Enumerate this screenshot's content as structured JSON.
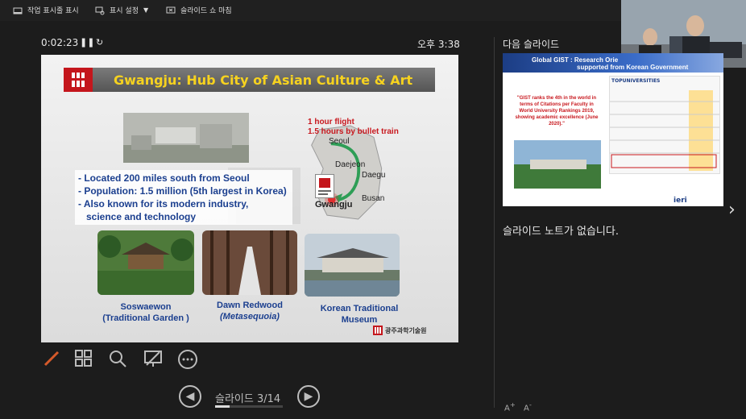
{
  "toolbar": {
    "taskbar_label": "작업 표시줄 표시",
    "display_settings_label": "표시 설정",
    "end_show_label": "슬라이드 쇼 마침"
  },
  "presenter": {
    "timer": "0:02:23",
    "clock": "오후 3:38",
    "next_slide_label": "다음 슬라이드",
    "notes_text": "슬라이드 노트가 없습니다.",
    "slide_counter": "슬라이드 3/14",
    "slide_progress": 0.2143
  },
  "current_slide": {
    "title": "Gwangju: Hub City of Asian Culture & Art",
    "bullets": [
      "- Located 200 miles south from Seoul",
      "- Population: 1.5 million (5th largest in Korea)",
      "- Also known for its modern industry,",
      "science and technology"
    ],
    "flight_lines": [
      "1 hour flight",
      "1.5 hours by bullet train"
    ],
    "map_labels": [
      "Seoul",
      "Daejeon",
      "Daegu",
      "Busan",
      "Gwangju"
    ],
    "captions": [
      {
        "line1": "Soswaewon",
        "line2": "(Traditional Garden )"
      },
      {
        "line1": "Dawn Redwood",
        "line2": "(Metasequoia)"
      },
      {
        "line1": "Korean Traditional Museum",
        "line2": ""
      }
    ],
    "footer_logo": "광주과학기술원"
  },
  "next_slide": {
    "header_line1": "Global GIST : Research Orie",
    "header_line2": "supported from Korean Government",
    "quote": "\"GIST ranks the 4th in the world in terms of Citations per Faculty in World University Rankings 2019, showing academic excellence (June 2020).\"",
    "topuni": "TOPUNIVERSITIES",
    "brand": "ieri"
  },
  "colors": {
    "background": "#1c1c1c",
    "title_text": "#f6d21f",
    "bullet_text": "#1b3f8f",
    "accent_red": "#c8181e"
  }
}
